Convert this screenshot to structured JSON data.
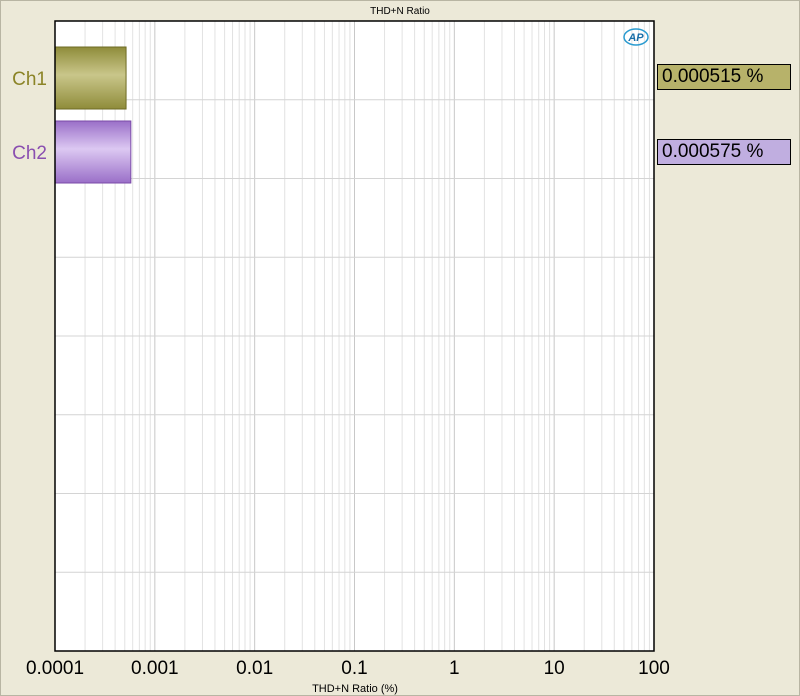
{
  "chart_data": {
    "type": "bar",
    "orientation": "horizontal",
    "title": "THD+N Ratio",
    "xlabel": "THD+N Ratio (%)",
    "ylabel": "",
    "x_scale": "log",
    "xlim": [
      0.0001,
      100
    ],
    "x_ticks": [
      "0.0001",
      "0.001",
      "0.01",
      "0.1",
      "1",
      "10",
      "100"
    ],
    "grid": true,
    "categories": [
      "Ch1",
      "Ch2"
    ],
    "values": [
      0.000515,
      0.000575
    ],
    "value_labels": [
      "0.000515 %",
      "0.000575 %"
    ],
    "colors": [
      "#a8a456",
      "#b493d8"
    ],
    "category_colors": [
      "#8b8426",
      "#8a4fb0"
    ]
  },
  "logo_text": "AP"
}
